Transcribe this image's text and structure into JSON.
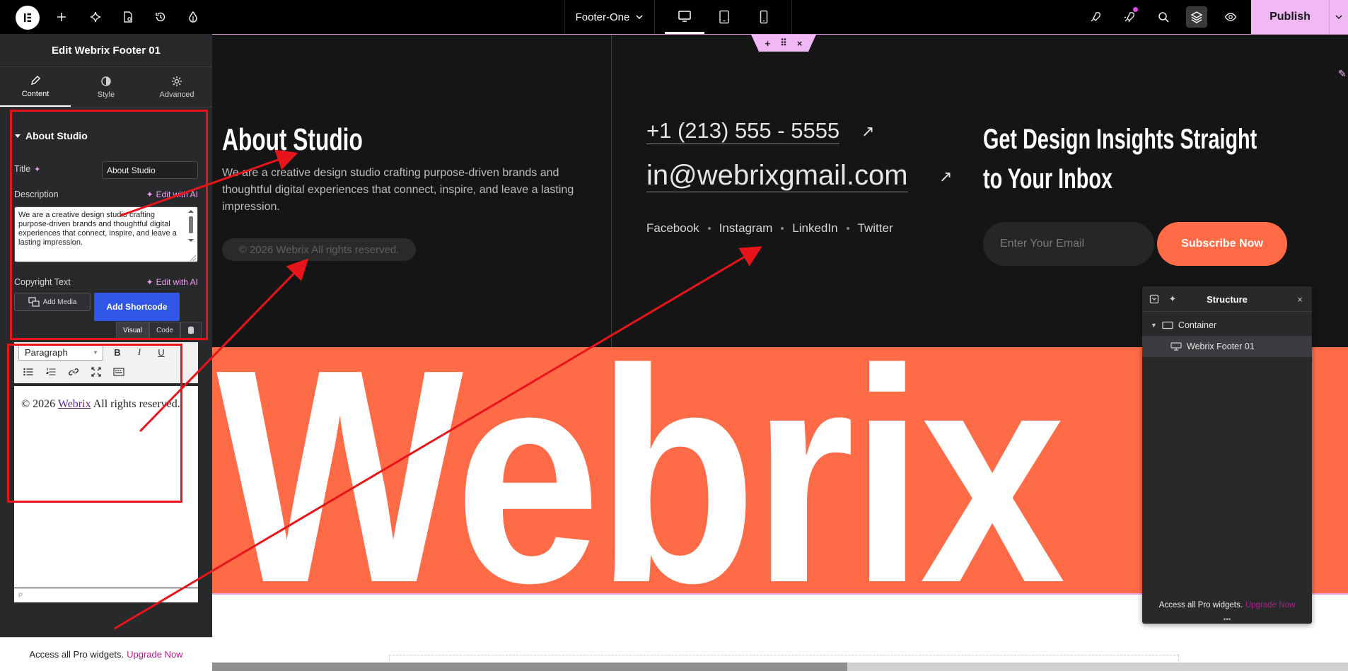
{
  "topbar": {
    "page_name": "Footer-One",
    "publish_label": "Publish",
    "icons": [
      "elementor-logo-icon",
      "add-icon",
      "ai-sparkle-icon",
      "page-settings-icon",
      "history-icon",
      "site-settings-drop-icon",
      "device-desktop-icon",
      "device-tablet-icon",
      "device-mobile-icon",
      "launch-icon",
      "notifications-icon",
      "search-icon",
      "layers-icon",
      "preview-eye-icon",
      "chevron-down-icon"
    ]
  },
  "panel": {
    "title": "Edit Webrix Footer 01",
    "tabs": [
      {
        "label": "Content"
      },
      {
        "label": "Style"
      },
      {
        "label": "Advanced"
      }
    ],
    "section_title": "About Studio",
    "title_label": "Title",
    "title_value": "About Studio",
    "description_label": "Description",
    "edit_with_ai": "Edit with AI",
    "description_value": "We are a creative design studio crafting purpose-driven brands and thoughtful digital experiences that connect, inspire, and leave a lasting impression.",
    "copyright_label": "Copyright Text",
    "add_media": "Add Media",
    "add_shortcode": "Add Shortcode",
    "mode_visual": "Visual",
    "mode_code": "Code",
    "format_value": "Paragraph",
    "editor_prefix": "© 2026",
    "editor_link": "Webrix",
    "editor_suffix": "All rights reserved.",
    "editor_status": "P",
    "footer_text": "Access all Pro widgets.",
    "footer_link": "Upgrade Now"
  },
  "canvas": {
    "about_title": "About Studio",
    "about_desc": "We are a creative design studio crafting purpose-driven brands and thoughtful digital experiences that connect, inspire, and leave a lasting impression.",
    "copyright": "© 2026 Webrix All rights reserved.",
    "phone": "+1 (213) 555 - 5555",
    "email": "in@webrixgmail.com",
    "socials": [
      "Facebook",
      "Instagram",
      "LinkedIn",
      "Twitter"
    ],
    "newsletter_line1": "Get Design Insights Straight",
    "newsletter_line2": "to Your Inbox",
    "email_placeholder": "Enter Your Email",
    "subscribe_label": "Subscribe Now",
    "banner_word": "Webrix"
  },
  "structure": {
    "title": "Structure",
    "items": [
      {
        "label": "Container"
      },
      {
        "label": "Webrix Footer 01"
      }
    ],
    "footer_text": "Access all Pro widgets.",
    "footer_link": "Upgrade Now"
  },
  "colors": {
    "accent_pink": "#f0b8f5",
    "brand_orange": "#ff6b47",
    "panel_bg": "#27292b",
    "footer_bg": "#151515",
    "annotation_red": "#e8141a",
    "shortcode_blue": "#3057e8"
  }
}
